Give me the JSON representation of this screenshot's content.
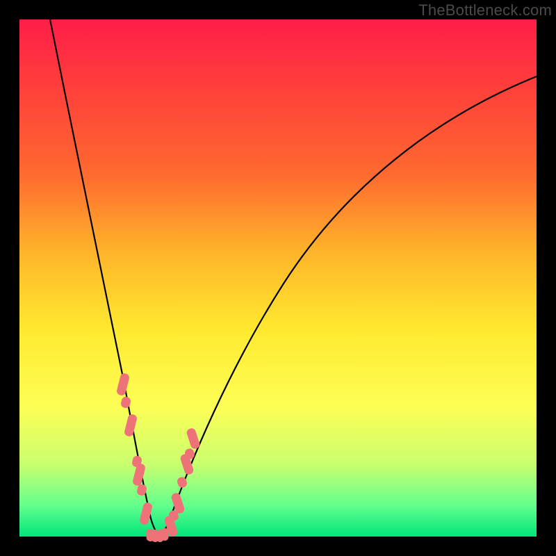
{
  "watermark": "TheBottleneck.com",
  "colors": {
    "frame_bg": "#000000",
    "marker": "#ee7379",
    "curve": "#000000",
    "gradient_stops": [
      "#ff1d49",
      "#ff3c3c",
      "#ff6a2f",
      "#ffb42a",
      "#ffe92f",
      "#fdff56",
      "#c9ff6e",
      "#62ff8d",
      "#00e57a"
    ]
  },
  "chart_data": {
    "type": "line",
    "title": "",
    "xlabel": "",
    "ylabel": "",
    "xlim": [
      0,
      100
    ],
    "ylim": [
      0,
      100
    ],
    "grid": false,
    "note": "Bottleneck curve — steep V. y estimated from vertical position (0=bottom, 100=top).",
    "x": [
      6,
      10,
      15,
      20,
      23,
      25,
      27,
      30,
      35,
      40,
      50,
      60,
      70,
      80,
      90,
      100
    ],
    "values": [
      100,
      80,
      55,
      29,
      12,
      3,
      0,
      3,
      20,
      35,
      53,
      65,
      74,
      80,
      85,
      89
    ],
    "series": [
      {
        "name": "markers-left-branch",
        "x": [
          20.0,
          20.6,
          21.5,
          22.7,
          23.1,
          23.6,
          24.4
        ],
        "y": [
          29.5,
          26.0,
          21.5,
          14.5,
          12.0,
          9.0,
          4.5
        ]
      },
      {
        "name": "markers-right-branch",
        "x": [
          29.3,
          29.9,
          30.6,
          31.5,
          32.4,
          32.9,
          33.6
        ],
        "y": [
          2.0,
          4.0,
          6.5,
          10.5,
          14.0,
          16.0,
          19.0
        ]
      },
      {
        "name": "markers-trough",
        "x": [
          25.3,
          26.2,
          27.2,
          28.1
        ],
        "y": [
          0.3,
          0.2,
          0.2,
          0.4
        ]
      }
    ]
  }
}
